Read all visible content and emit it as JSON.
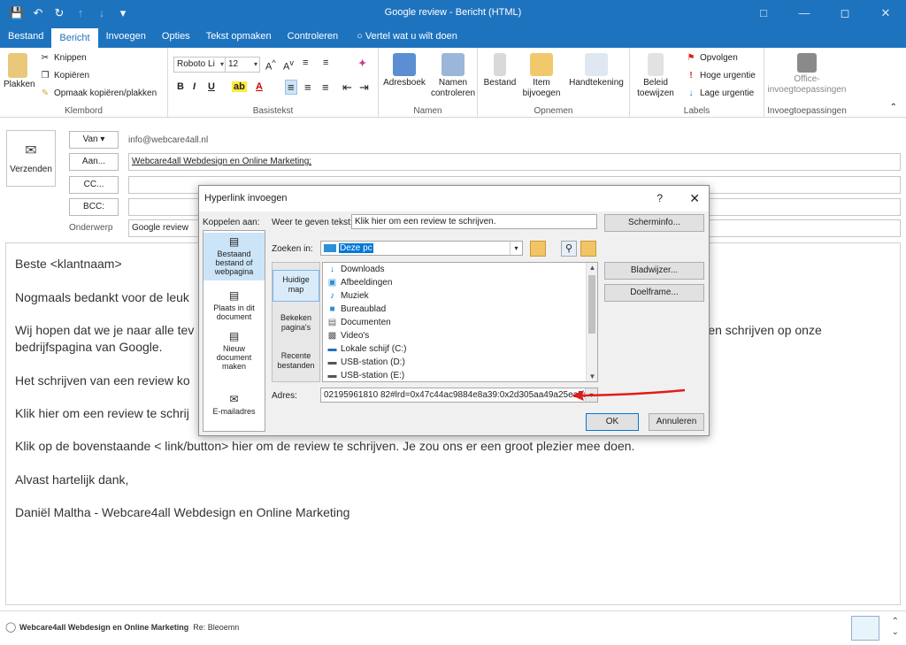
{
  "window": {
    "title": "Google review  -  Bericht (HTML)"
  },
  "tabs": [
    "Bestand",
    "Bericht",
    "Invoegen",
    "Opties",
    "Tekst opmaken",
    "Controleren",
    "Vertel wat u wilt doen"
  ],
  "ribbon": {
    "clipboard": {
      "paste": "Plakken",
      "cut": "Knippen",
      "copy": "Kopiëren",
      "format_painter": "Opmaak kopiëren/plakken",
      "label": "Klembord"
    },
    "basic_text": {
      "font": "Roboto Li",
      "size": "12",
      "label": "Basistekst"
    },
    "names": {
      "address_book": "Adresboek",
      "check_names_1": "Namen",
      "check_names_2": "controleren",
      "label": "Namen"
    },
    "include": {
      "file": "Bestand",
      "item_1": "Item",
      "item_2": "bijvoegen",
      "signature": "Handtekening",
      "label": "Opnemen"
    },
    "tags": {
      "assign_1": "Beleid",
      "assign_2": "toewijzen",
      "follow_up": "Opvolgen",
      "high": "Hoge urgentie",
      "low": "Lage urgentie",
      "label": "Labels"
    },
    "addins": {
      "office_1": "Office-",
      "office_2": "invoegtoepassingen",
      "label": "Invoegtoepassingen"
    }
  },
  "message": {
    "send": "Verzenden",
    "from_btn": "Van",
    "from_value": "info@webcare4all.nl",
    "to_btn": "Aan...",
    "to_value": "Webcare4all Webdesign en Online Marketing;",
    "cc_btn": "CC...",
    "bcc_btn": "BCC:",
    "subject_label": "Onderwerp",
    "subject_value": "Google review"
  },
  "body": {
    "p1": "Beste <klantnaam>",
    "p2": "Nogmaals bedankt voor de leuk",
    "p3a": "Wij hopen dat we je naar alle tev",
    "p3b": "illen schrijven op onze",
    "p3c": "bedrijfspagina van Google.",
    "p4": "Het schrijven van een review ko",
    "p5": "Klik hier om een review te schrij",
    "p6": "Klik op de bovenstaande < link/button> hier om de review te schrijven. Je zou ons er een groot plezier mee doen.",
    "p7": "Alvast hartelijk dank,",
    "p8": "Daniël Maltha - Webcare4all Webdesign en Online Marketing"
  },
  "status": {
    "sender": "Webcare4all Webdesign en Online Marketing",
    "subject": "Re: Bleoemn"
  },
  "dialog": {
    "title": "Hyperlink invoegen",
    "help": "?",
    "close": "✕",
    "link_to": "Koppelen aan:",
    "display_label": "Weer te geven tekst:",
    "display_value": "Klik hier om een review te schrijven.",
    "screentip": "Scherminfo...",
    "look_in_label": "Zoeken in:",
    "look_in_value": "Deze pc",
    "bookmark": "Bladwijzer...",
    "target_frame": "Doelframe...",
    "address_label": "Adres:",
    "address_value": "02195961810 82#lrd=0x47c44ac9884e8a39:0x2d305aa49a25ea5a;3",
    "ok": "OK",
    "cancel": "Annuleren",
    "link_pane": [
      {
        "l1": "Bestaand",
        "l2": "bestand of",
        "l3": "webpagina"
      },
      {
        "l1": "Plaats in dit",
        "l2": "document",
        "l3": ""
      },
      {
        "l1": "Nieuw",
        "l2": "document",
        "l3": "maken"
      },
      {
        "l1": "E-mailadres",
        "l2": "",
        "l3": ""
      }
    ],
    "side": [
      {
        "l1": "Huidige",
        "l2": "map"
      },
      {
        "l1": "Bekeken",
        "l2": "pagina's"
      },
      {
        "l1": "Recente",
        "l2": "bestanden"
      }
    ],
    "files": [
      "Downloads",
      "Afbeeldingen",
      "Muziek",
      "Bureaublad",
      "Documenten",
      "Video's",
      "Lokale schijf (C:)",
      "USB-station (D:)",
      "USB-station (E:)"
    ]
  },
  "colors": {
    "brand": "#1e73be",
    "annotation": "#e11b1b",
    "selection": "#0078d7"
  }
}
